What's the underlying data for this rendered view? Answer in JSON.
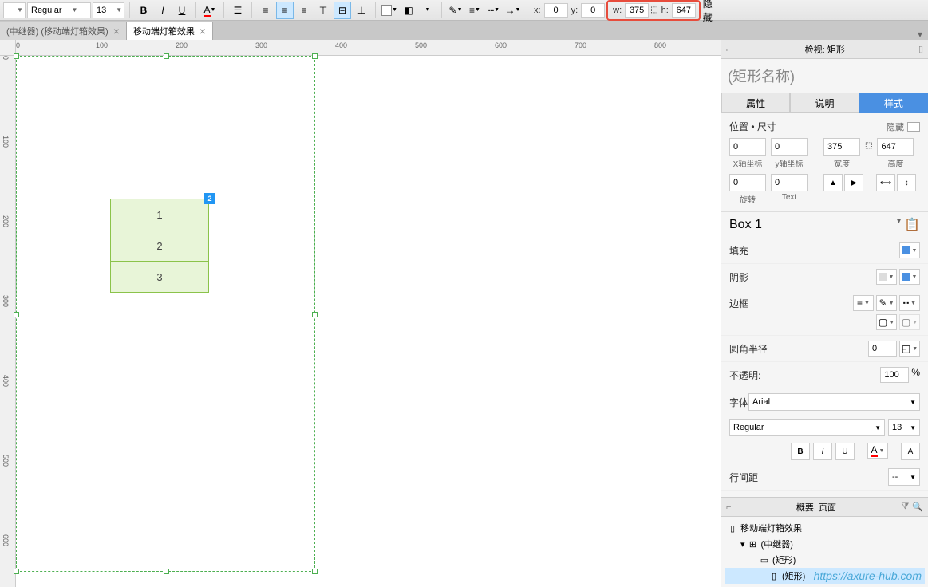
{
  "toolbar": {
    "font_weight": "Regular",
    "font_size": "13",
    "bold": "B",
    "italic": "I",
    "underline": "U",
    "x_label": "x:",
    "x_value": "0",
    "y_label": "y:",
    "y_value": "0",
    "w_label": "w:",
    "w_value": "375",
    "h_label": "h:",
    "h_value": "647",
    "hide_label": "隐藏"
  },
  "tabs": [
    {
      "label": "(中继器) (移动端灯箱效果)",
      "active": false
    },
    {
      "label": "移动端灯箱效果",
      "active": true
    }
  ],
  "ruler_h": [
    "0",
    "100",
    "200",
    "300",
    "400",
    "500",
    "600",
    "700",
    "800"
  ],
  "ruler_v": [
    "0",
    "100",
    "200",
    "300",
    "400",
    "500",
    "600"
  ],
  "repeater": {
    "badge": "2",
    "rows": [
      "1",
      "2",
      "3"
    ]
  },
  "inspector": {
    "header": "检视: 矩形",
    "shape_name": "(矩形名称)",
    "tabs": {
      "props": "属性",
      "notes": "说明",
      "style": "样式"
    },
    "pos_size": {
      "title": "位置 • 尺寸",
      "hide": "隐藏",
      "x": "0",
      "x_label": "X轴坐标",
      "y": "0",
      "y_label": "y轴坐标",
      "w": "375",
      "w_label": "宽度",
      "h": "647",
      "h_label": "高度",
      "rot": "0",
      "rot_label": "旋转",
      "text_rot": "0",
      "text_label": "Text"
    },
    "box_name": "Box 1",
    "fill": "填充",
    "shadow": "阴影",
    "border": "边框",
    "radius": "圆角半径",
    "radius_value": "0",
    "opacity": "不透明:",
    "opacity_value": "100",
    "opacity_unit": "%",
    "font_label": "字体",
    "font_family": "Arial",
    "font_weight": "Regular",
    "font_size": "13",
    "line_height": "行间距",
    "line_height_value": "--"
  },
  "outline": {
    "header": "概要: 页面",
    "items": [
      {
        "icon": "page",
        "label": "移动端灯箱效果",
        "indent": 0
      },
      {
        "icon": "repeater",
        "label": "(中继器)",
        "indent": 1,
        "expanded": true
      },
      {
        "icon": "rect",
        "label": "(矩形)",
        "indent": 2
      },
      {
        "icon": "rect",
        "label": "(矩形)",
        "indent": 3,
        "selected": true
      }
    ]
  },
  "watermark": "https://axure-hub.com"
}
